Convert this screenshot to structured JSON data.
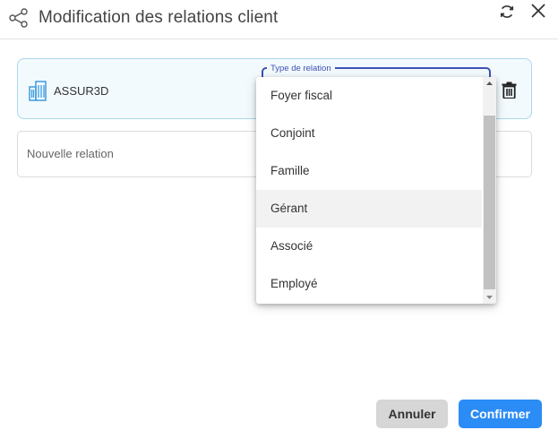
{
  "dialog": {
    "title": "Modification des relations client",
    "icons": {
      "header": "share-icon",
      "refresh": "refresh-icon",
      "close": "close-icon"
    }
  },
  "relation": {
    "client_name": "ASSUR3D",
    "icon": "building-icon",
    "delete_icon": "trash-icon",
    "select_label": "Type de relation"
  },
  "new_relation": {
    "placeholder": "Nouvelle relation"
  },
  "dropdown": {
    "options": [
      "Foyer fiscal",
      "Conjoint",
      "Famille",
      "Gérant",
      "Associé",
      "Employé"
    ],
    "highlighted": "Gérant"
  },
  "footer": {
    "cancel_label": "Annuler",
    "confirm_label": "Confirmer"
  },
  "colors": {
    "accent": "#2b8cf5",
    "select_outline": "#3f51b5",
    "card_background": "#f3fafd",
    "card_border": "#a9d8ea",
    "building_icon": "#3d9be0"
  }
}
